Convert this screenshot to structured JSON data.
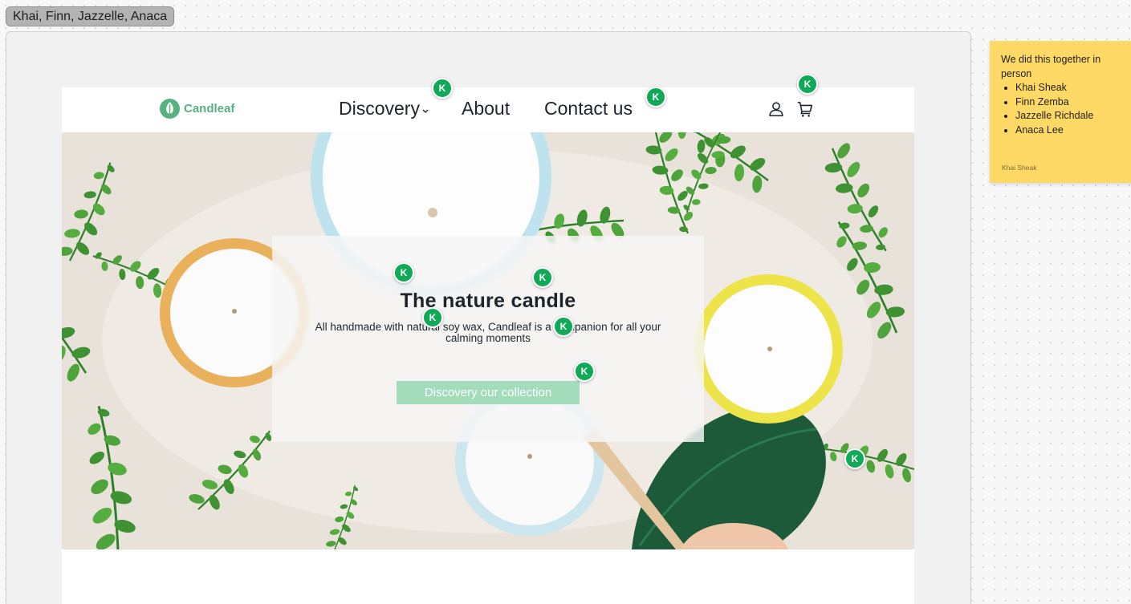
{
  "canvas": {
    "frame_label": "Khai, Finn, Jazzelle, Anaca"
  },
  "site": {
    "brand": "Candleaf",
    "nav": {
      "discovery": "Discovery",
      "about": "About",
      "contact": "Contact us"
    },
    "hero": {
      "title": "The nature candle",
      "subtitle": "All handmade with natural soy wax, Candleaf is a companion for all your calming moments",
      "cta": "Discovery our collection"
    }
  },
  "cursor_avatar_initial": "K",
  "sticky_note": {
    "heading": "We did this together in person",
    "members": [
      "Khai Sheak",
      "Finn Zemba",
      "Jazzelle Richdale",
      "Anaca Lee"
    ],
    "author": "Khai Sheak"
  },
  "colors": {
    "brand_green": "#56b280",
    "button_green": "#a3dcbb",
    "avatar_green": "#0fa958",
    "sticky_yellow": "#ffd966"
  },
  "icons": [
    "leaf-logo-icon",
    "chevron-down-icon",
    "user-icon",
    "cart-icon"
  ]
}
